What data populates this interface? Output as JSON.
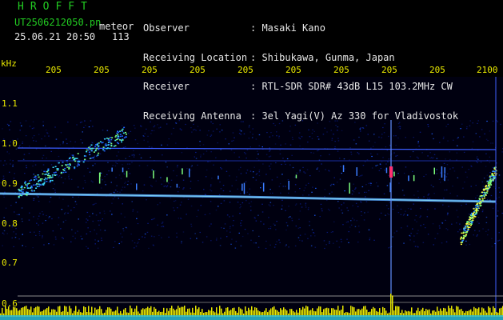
{
  "header": {
    "logo": "HROFFT",
    "filename": "UT2506212050.pn",
    "mode_label": "meteor",
    "datetime": "25.06.21 20:50",
    "meteor_count": "113"
  },
  "station": {
    "labels": [
      "Observer",
      "Receiving Location",
      "Receiver",
      "Receiving Antenna"
    ],
    "values": [
      ": Masaki Kano",
      ": Shibukawa, Gunma, Japan",
      ": RTL-SDR SDR# 43dB L15 103.2MHz CW",
      ": 3el Yagi(V) Az 330 for Vladivostok"
    ]
  },
  "axes": {
    "y_unit": "kHz",
    "x_ticks": [
      "205",
      "205",
      "205",
      "205",
      "205",
      "205",
      "205",
      "205",
      "205",
      "2100"
    ],
    "y_ticks": [
      "1.1",
      "1.0",
      "0.9",
      "0.8",
      "0.7",
      "0.6"
    ]
  },
  "colors": {
    "text_green": "#22cc22",
    "text_white": "#e6e6e6",
    "tick_yellow": "#e8e800",
    "background": "#000000"
  }
}
